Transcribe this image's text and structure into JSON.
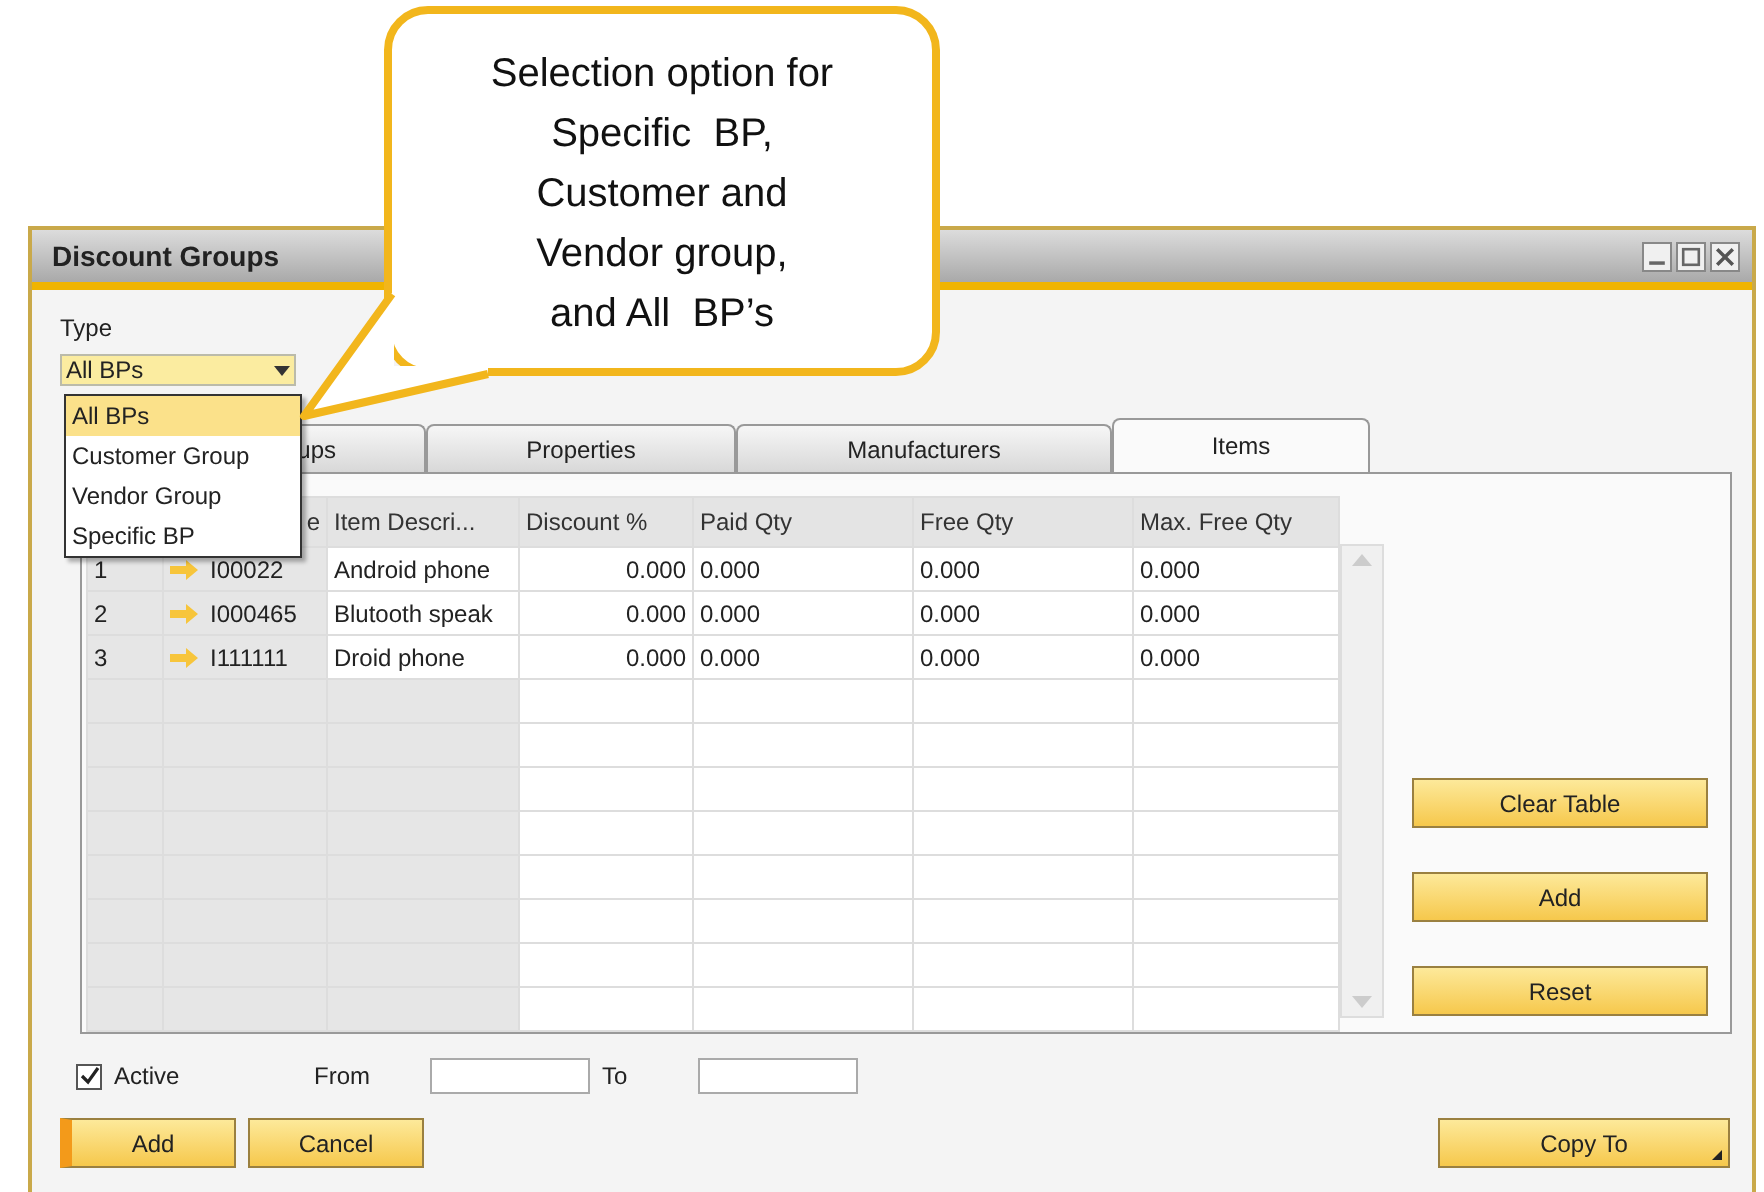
{
  "callout": {
    "text": "Selection option for\nSpecific  BP,\nCustomer and\nVendor group,\nand All  BP’s"
  },
  "window": {
    "title": "Discount Groups"
  },
  "type_field": {
    "label": "Type",
    "value": "All BPs"
  },
  "type_options": [
    {
      "label": "All BPs",
      "selected": true
    },
    {
      "label": "Customer Group",
      "selected": false
    },
    {
      "label": "Vendor Group",
      "selected": false
    },
    {
      "label": "Specific BP",
      "selected": false
    }
  ],
  "tabs": [
    {
      "label": "ups",
      "selected": false
    },
    {
      "label": "Properties",
      "selected": false
    },
    {
      "label": "Manufacturers",
      "selected": false
    },
    {
      "label": "Items",
      "selected": true
    }
  ],
  "table": {
    "columns": [
      {
        "kind": "index"
      },
      {
        "kind": "link",
        "header": "e"
      },
      {
        "kind": "text",
        "header": "Item Descri..."
      },
      {
        "kind": "number",
        "header": "Discount %"
      },
      {
        "kind": "text",
        "header": "Paid Qty"
      },
      {
        "kind": "text",
        "header": "Free Qty"
      },
      {
        "kind": "text",
        "header": "Max. Free Qty"
      }
    ],
    "rows": [
      [
        "1",
        "I00022",
        "Android phone",
        "0.000",
        "0.000",
        "0.000",
        "0.000"
      ],
      [
        "2",
        "I000465",
        "Blutooth speak",
        "0.000",
        "0.000",
        "0.000",
        "0.000"
      ],
      [
        "3",
        "I111111",
        "Droid phone",
        "0.000",
        "0.000",
        "0.000",
        "0.000"
      ]
    ]
  },
  "side_buttons": [
    "Clear Table",
    "Add",
    "Reset"
  ],
  "active": {
    "label": "Active",
    "checked": true
  },
  "from_label": "From",
  "to_label": "To",
  "buttons": [
    {
      "label": "Add",
      "primary": true,
      "menu": false
    },
    {
      "label": "Cancel",
      "primary": false,
      "menu": false
    },
    {
      "label": "Copy To",
      "primary": false,
      "menu": true
    }
  ]
}
